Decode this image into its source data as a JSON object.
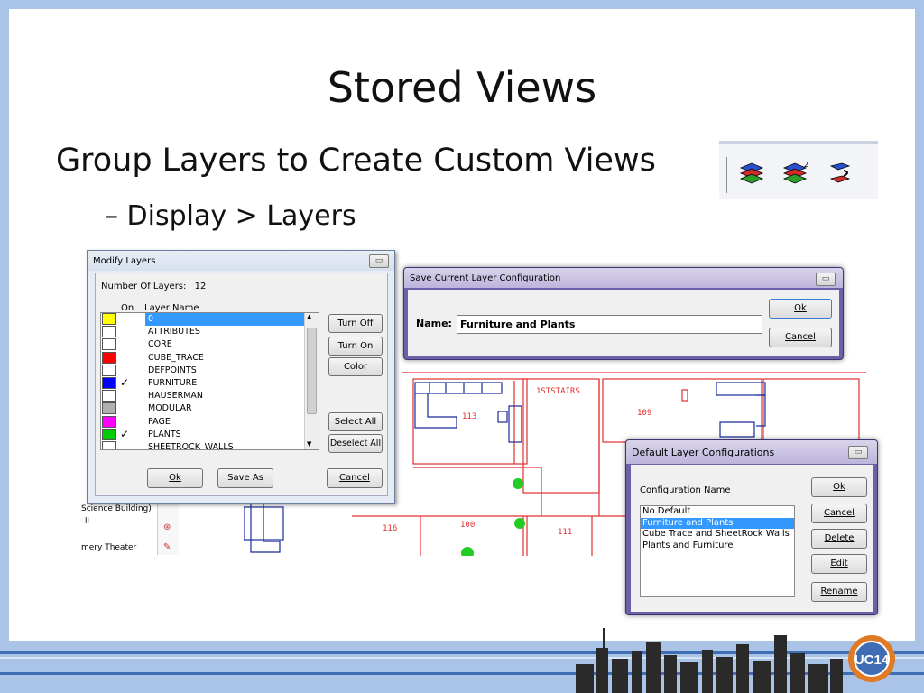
{
  "slide": {
    "title": "Stored Views",
    "bullet1": "Group Layers to Create Custom Views",
    "bullet2": "– Display > Layers"
  },
  "toolbar_icons": [
    "layers-stack-icon",
    "layers-save-icon",
    "layers-restore-icon"
  ],
  "modify_layers": {
    "title": "Modify Layers",
    "count_label": "Number Of Layers:",
    "count_value": "12",
    "col_on": "On",
    "col_name": "Layer Name",
    "layers": [
      {
        "name": "0",
        "color": "#ffff00",
        "checked": false,
        "selected": true
      },
      {
        "name": "ATTRIBUTES",
        "color": "#ffffff",
        "checked": false,
        "selected": false
      },
      {
        "name": "CORE",
        "color": "#ffffff",
        "checked": false,
        "selected": false
      },
      {
        "name": "CUBE_TRACE",
        "color": "#ff0000",
        "checked": false,
        "selected": false
      },
      {
        "name": "DEFPOINTS",
        "color": "#ffffff",
        "checked": false,
        "selected": false
      },
      {
        "name": "FURNITURE",
        "color": "#0000ff",
        "checked": true,
        "selected": false
      },
      {
        "name": "HAUSERMAN",
        "color": "#ffffff",
        "checked": false,
        "selected": false
      },
      {
        "name": "MODULAR",
        "color": "#b0b0b0",
        "checked": false,
        "selected": false
      },
      {
        "name": "PAGE",
        "color": "#ff00ff",
        "checked": false,
        "selected": false
      },
      {
        "name": "PLANTS",
        "color": "#00cc00",
        "checked": true,
        "selected": false
      },
      {
        "name": "SHEETROCK_WALLS",
        "color": "#ffffff",
        "checked": false,
        "selected": false
      }
    ],
    "btn_turn_off": "Turn Off",
    "btn_turn_on": "Turn On",
    "btn_color": "Color",
    "btn_select_all": "Select All",
    "btn_deselect_all": "Deselect All",
    "btn_ok": "Ok",
    "btn_save_as": "Save As",
    "btn_cancel": "Cancel"
  },
  "save_config": {
    "title": "Save Current Layer Configuration",
    "name_label": "Name:",
    "name_value": "Furniture and Plants",
    "btn_ok": "Ok",
    "btn_cancel": "Cancel"
  },
  "default_configs": {
    "title": "Default Layer Configurations",
    "list_label": "Configuration Name",
    "items": [
      {
        "name": "No Default",
        "selected": false
      },
      {
        "name": "Furniture and Plants",
        "selected": true
      },
      {
        "name": "Cube Trace and SheetRock Walls",
        "selected": false
      },
      {
        "name": "Plants and Furniture",
        "selected": false
      }
    ],
    "btn_ok": "Ok",
    "btn_cancel": "Cancel",
    "btn_delete": "Delete",
    "btn_edit": "Edit",
    "btn_rename": "Rename"
  },
  "floorplan": {
    "room_113": "113",
    "room_109": "109",
    "stairs": "1STSTAIRS",
    "room_116": "116",
    "room_100": "100",
    "room_111": "111"
  },
  "left_panel": {
    "item1": "Science Building)",
    "item2": "ll",
    "item3": "mery Theater"
  },
  "logo": {
    "text": "UC14"
  }
}
